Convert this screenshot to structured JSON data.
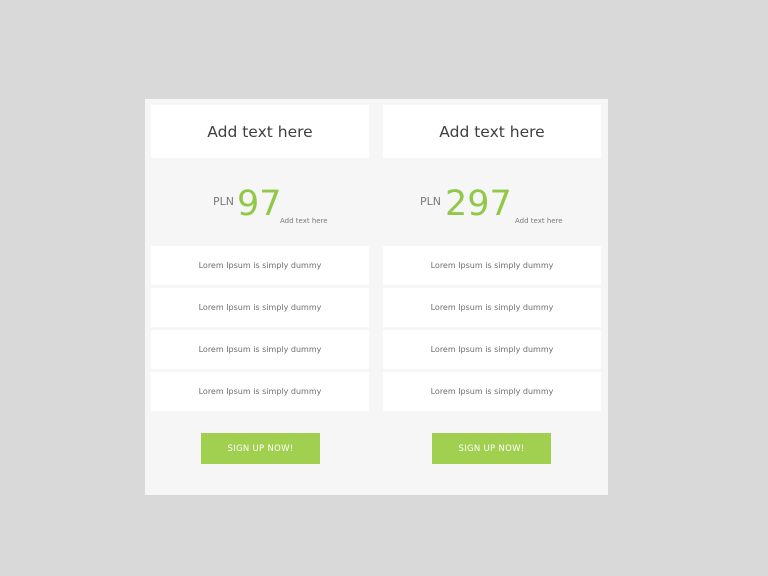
{
  "colors": {
    "background": "#d9d9d9",
    "panel": "#f6f6f6",
    "card": "#ffffff",
    "accent_green": "#92c84a",
    "button_green": "#a1cf4f"
  },
  "plans": [
    {
      "title": "Add text here",
      "currency": "PLN",
      "price": "97",
      "price_note": "Add text here",
      "features": [
        "Lorem Ipsum is simply dummy",
        "Lorem Ipsum is simply dummy",
        "Lorem Ipsum is simply dummy",
        "Lorem Ipsum is simply dummy"
      ],
      "cta_label": "SIGN UP NOW!"
    },
    {
      "title": "Add text here",
      "currency": "PLN",
      "price": "297",
      "price_note": "Add text here",
      "features": [
        "Lorem Ipsum is simply dummy",
        "Lorem Ipsum is simply dummy",
        "Lorem Ipsum is simply dummy",
        "Lorem Ipsum is simply dummy"
      ],
      "cta_label": "SIGN UP NOW!"
    }
  ]
}
